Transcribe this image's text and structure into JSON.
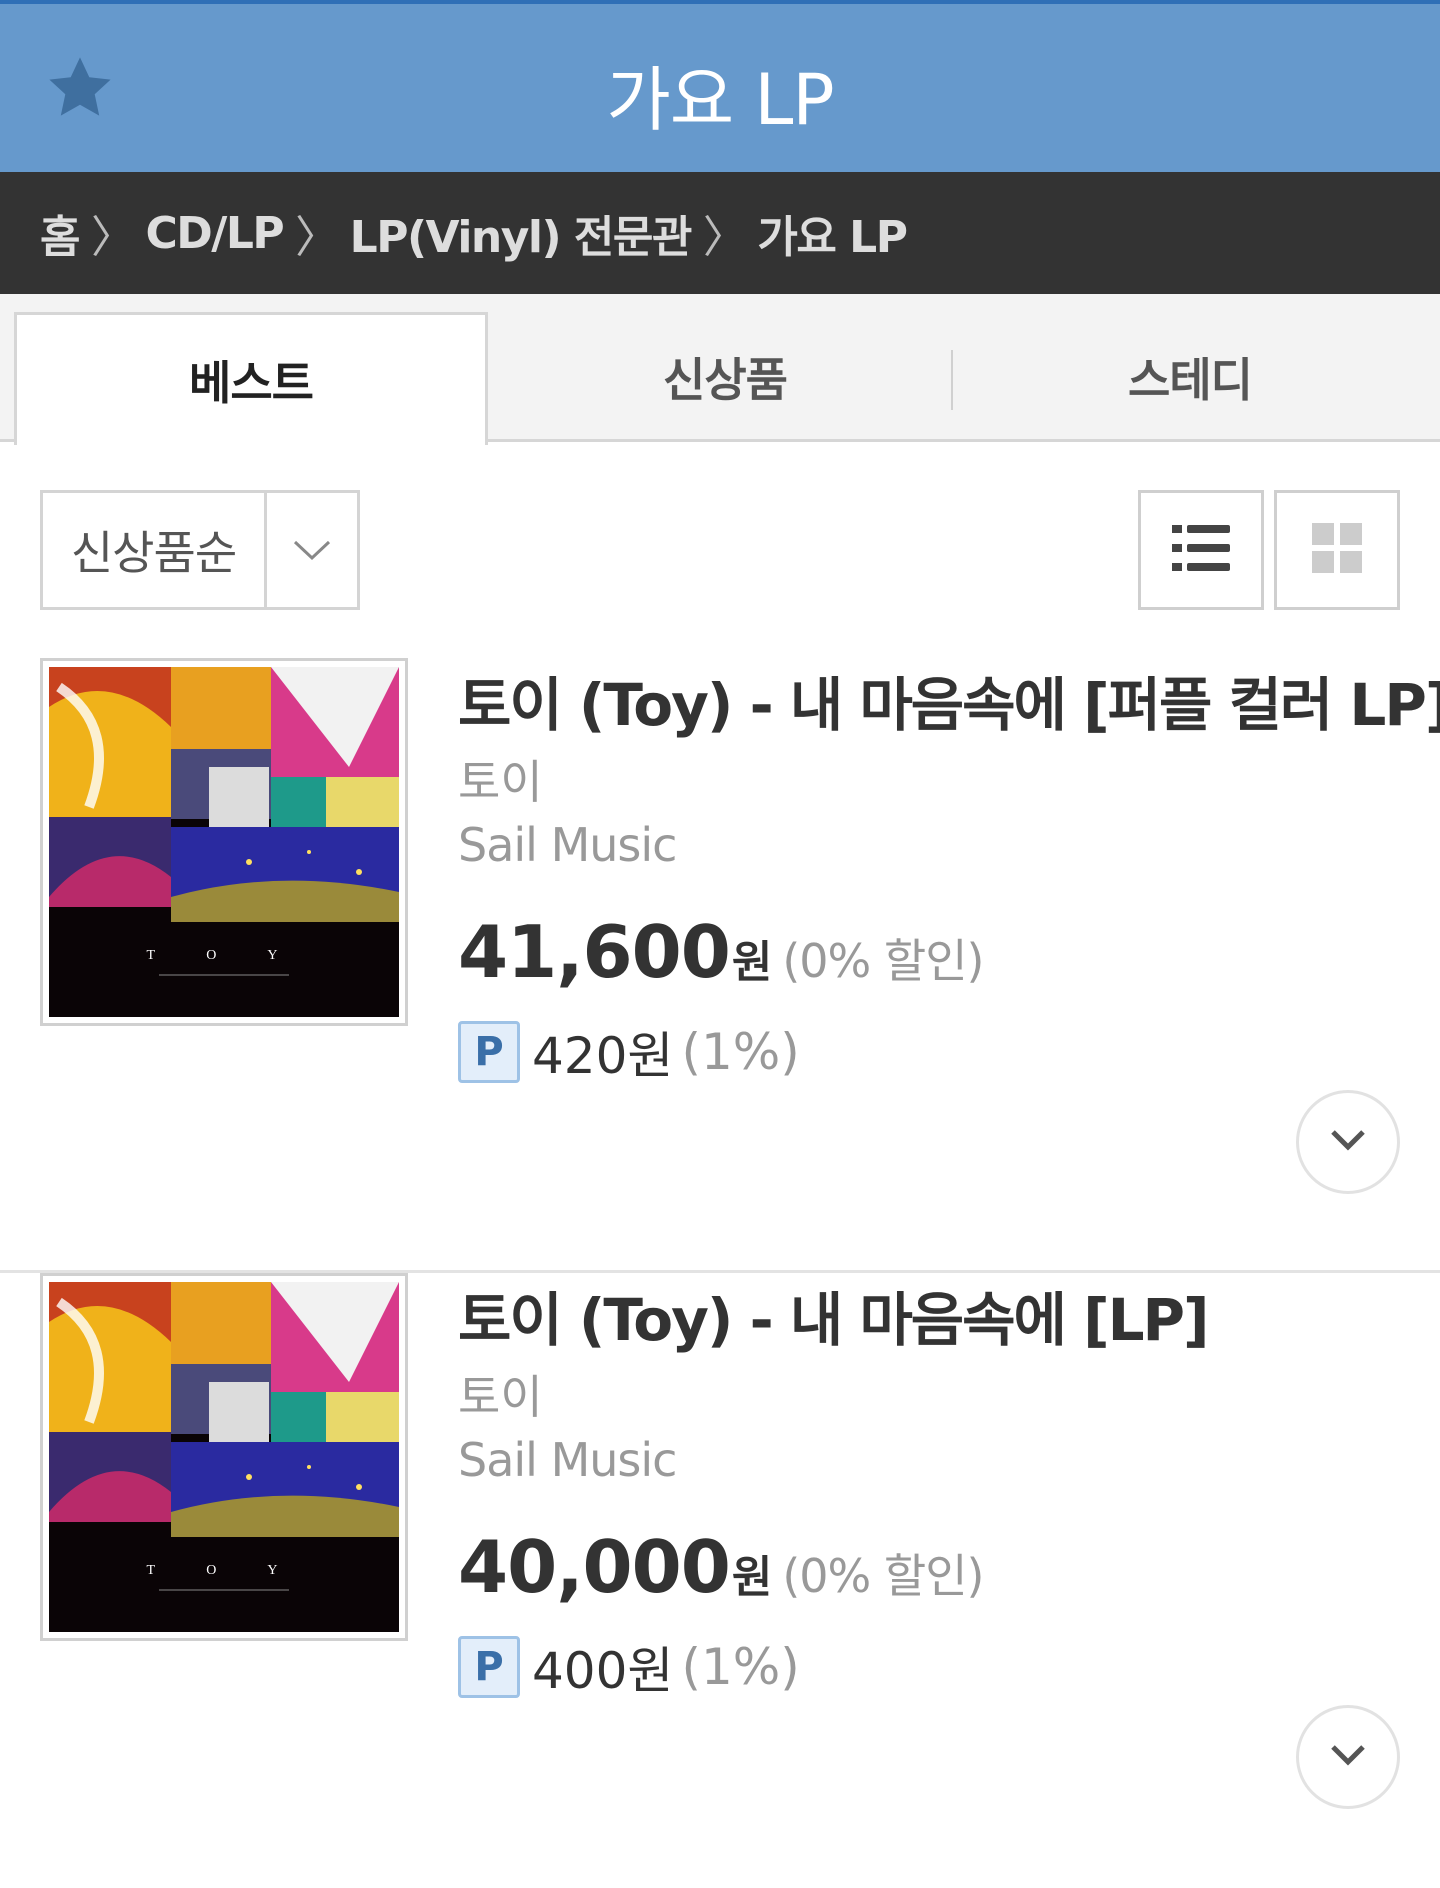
{
  "header": {
    "title": "가요 LP",
    "favorite_icon": "star-icon"
  },
  "breadcrumb": {
    "items": [
      "홈",
      "CD/LP",
      "LP(Vinyl) 전문관",
      "가요 LP"
    ],
    "separator": "〉"
  },
  "tabs": [
    {
      "label": "베스트",
      "active": true
    },
    {
      "label": "신상품",
      "active": false
    },
    {
      "label": "스테디",
      "active": false
    }
  ],
  "sort": {
    "selected": "신상품순",
    "icon": "chevron-down-icon"
  },
  "view_modes": [
    {
      "name": "list-view",
      "icon": "list-icon",
      "active": true
    },
    {
      "name": "grid-view",
      "icon": "grid-icon",
      "active": false
    }
  ],
  "products": [
    {
      "title": "토이 (Toy) - 내 마음속에 [퍼플 컬러 LP]",
      "artist": "토이",
      "label": "Sail Music",
      "price": "41,600",
      "currency": "원",
      "discount": "(0% 할인)",
      "point_badge": "P",
      "point": "420원",
      "point_rate": "(1%)",
      "cover_text": "T O Y"
    },
    {
      "title": "토이 (Toy) - 내 마음속에 [LP]",
      "artist": "토이",
      "label": "Sail Music",
      "price": "40,000",
      "currency": "원",
      "discount": "(0% 할인)",
      "point_badge": "P",
      "point": "400원",
      "point_rate": "(1%)",
      "cover_text": "T O Y"
    }
  ],
  "colors": {
    "header_bg": "#6699cc",
    "breadcrumb_bg": "#333333",
    "point_badge_bg": "#e3eefa"
  }
}
